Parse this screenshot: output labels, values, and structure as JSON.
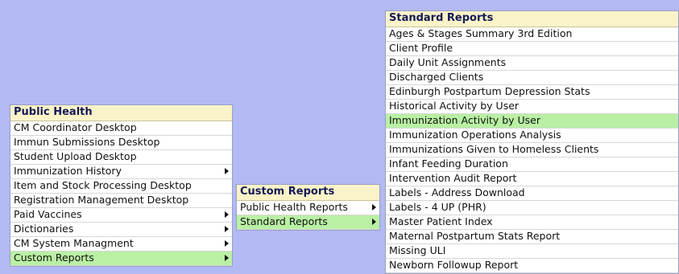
{
  "public_health_menu": {
    "title": "Public Health",
    "items": [
      {
        "label": "CM Coordinator Desktop",
        "submenu": false,
        "selected": false
      },
      {
        "label": "Immun Submissions Desktop",
        "submenu": false,
        "selected": false
      },
      {
        "label": "Student Upload Desktop",
        "submenu": false,
        "selected": false
      },
      {
        "label": "Immunization History",
        "submenu": true,
        "selected": false
      },
      {
        "label": "Item and Stock Processing Desktop",
        "submenu": false,
        "selected": false
      },
      {
        "label": "Registration Management Desktop",
        "submenu": false,
        "selected": false
      },
      {
        "label": "Paid Vaccines",
        "submenu": true,
        "selected": false
      },
      {
        "label": "Dictionaries",
        "submenu": true,
        "selected": false
      },
      {
        "label": "CM System Managment",
        "submenu": true,
        "selected": false
      },
      {
        "label": "Custom Reports",
        "submenu": true,
        "selected": true
      }
    ]
  },
  "custom_reports_menu": {
    "title": "Custom Reports",
    "items": [
      {
        "label": "Public Health Reports",
        "submenu": true,
        "selected": false
      },
      {
        "label": "Standard Reports",
        "submenu": true,
        "selected": true
      }
    ]
  },
  "standard_reports_menu": {
    "title": "Standard Reports",
    "items": [
      {
        "label": "Ages & Stages Summary 3rd Edition",
        "selected": false
      },
      {
        "label": "Client Profile",
        "selected": false
      },
      {
        "label": "Daily Unit Assignments",
        "selected": false
      },
      {
        "label": "Discharged Clients",
        "selected": false
      },
      {
        "label": "Edinburgh Postpartum Depression Stats",
        "selected": false
      },
      {
        "label": "Historical Activity by User",
        "selected": false
      },
      {
        "label": "Immunization Activity by User",
        "selected": true
      },
      {
        "label": "Immunization Operations Analysis",
        "selected": false
      },
      {
        "label": "Immunizations Given to Homeless Clients",
        "selected": false
      },
      {
        "label": "Infant Feeding Duration",
        "selected": false
      },
      {
        "label": "Intervention Audit Report",
        "selected": false
      },
      {
        "label": "Labels - Address Download",
        "selected": false
      },
      {
        "label": "Labels - 4 UP (PHR)",
        "selected": false
      },
      {
        "label": "Master Patient Index",
        "selected": false
      },
      {
        "label": "Maternal Postpartum Stats Report",
        "selected": false
      },
      {
        "label": "Missing ULI",
        "selected": false
      },
      {
        "label": "Newborn Followup Report",
        "selected": false
      }
    ]
  },
  "colors": {
    "desktop_background": "#b3b9f2",
    "header_background": "#fbf3c8",
    "header_text": "#131a57",
    "selected_background": "#b9f0a4"
  }
}
